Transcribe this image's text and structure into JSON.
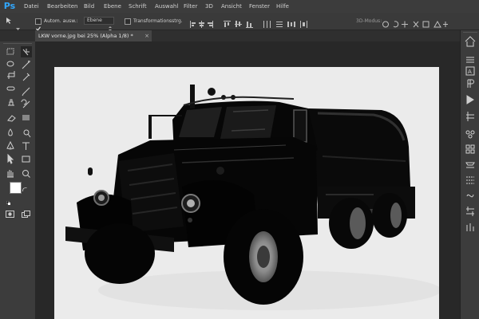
{
  "app": {
    "logo": "Ps"
  },
  "menu": [
    "Datei",
    "Bearbeiten",
    "Bild",
    "Ebene",
    "Schrift",
    "Auswahl",
    "Filter",
    "3D",
    "Ansicht",
    "Fenster",
    "Hilfe"
  ],
  "options": {
    "auto_select_label": "Autom. ausw.:",
    "auto_select_checked": true,
    "auto_select_target": "Ebene",
    "transform_label": "Transformationsstrg.",
    "transform_checked": false,
    "mode_3d_label": "3D-Modus:"
  },
  "document": {
    "tab_title": "LKW vorne.jpg bei 25% (Alpha 1/8) *",
    "close_glyph": "×"
  },
  "icons": {
    "left_toolbar": [
      "rectangular-marquee",
      "move",
      "lasso",
      "magic-wand",
      "crop",
      "eyedropper",
      "spot-healing-brush",
      "brush",
      "clone-stamp",
      "history-brush",
      "eraser",
      "gradient",
      "blur",
      "dodge",
      "pen",
      "type",
      "path-selection",
      "rectangle",
      "hand",
      "zoom"
    ],
    "right_dock": [
      "arrange",
      "history",
      "character",
      "paragraph",
      "actions",
      "properties",
      "brush-presets",
      "swatches",
      "layers",
      "channels",
      "paths",
      "adjustments"
    ]
  },
  "colors": {
    "foreground": "#ffffff",
    "background": "#000000",
    "accent": "#31a8ff"
  }
}
